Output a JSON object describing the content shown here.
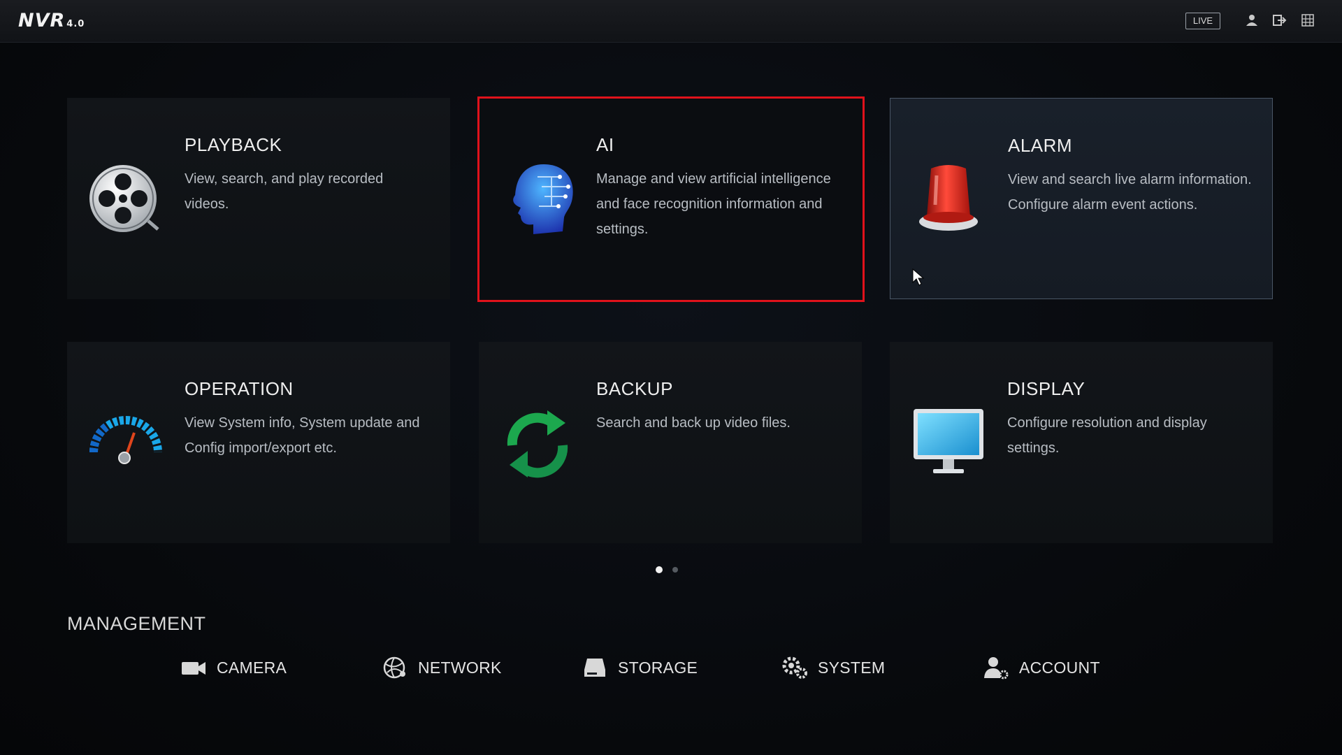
{
  "topbar": {
    "logo": "NVR",
    "logo_version": "4.0",
    "live_label": "LIVE",
    "icons": [
      "user-icon",
      "exit-icon",
      "grid-icon"
    ]
  },
  "tiles": [
    {
      "title": "PLAYBACK",
      "description": "View, search, and play recorded videos.",
      "icon": "film-reel-icon"
    },
    {
      "title": "AI",
      "description": "Manage and view artificial intelligence and face recognition information and settings.",
      "icon": "ai-head-icon",
      "selected": true
    },
    {
      "title": "ALARM",
      "description": "View and search live alarm information. Configure alarm event actions.",
      "icon": "alarm-light-icon",
      "hovered": true
    },
    {
      "title": "OPERATION",
      "description": "View System info, System update and Config import/export etc.",
      "icon": "gauge-icon"
    },
    {
      "title": "BACKUP",
      "description": "Search and back up video files.",
      "icon": "refresh-icon"
    },
    {
      "title": "DISPLAY",
      "description": "Configure resolution and display settings.",
      "icon": "monitor-icon"
    }
  ],
  "pagination": {
    "current_page": 1,
    "total_pages": 2
  },
  "management": {
    "title": "MANAGEMENT",
    "items": [
      {
        "label": "CAMERA",
        "icon": "camera-icon"
      },
      {
        "label": "NETWORK",
        "icon": "network-globe-icon"
      },
      {
        "label": "STORAGE",
        "icon": "storage-drive-icon"
      },
      {
        "label": "SYSTEM",
        "icon": "gears-icon"
      },
      {
        "label": "ACCOUNT",
        "icon": "account-icon"
      }
    ]
  },
  "colors": {
    "selection_border": "#e0121b",
    "accent_blue": "#1aa7e8",
    "alarm_red": "#d6261c",
    "backup_green": "#19a64a"
  }
}
